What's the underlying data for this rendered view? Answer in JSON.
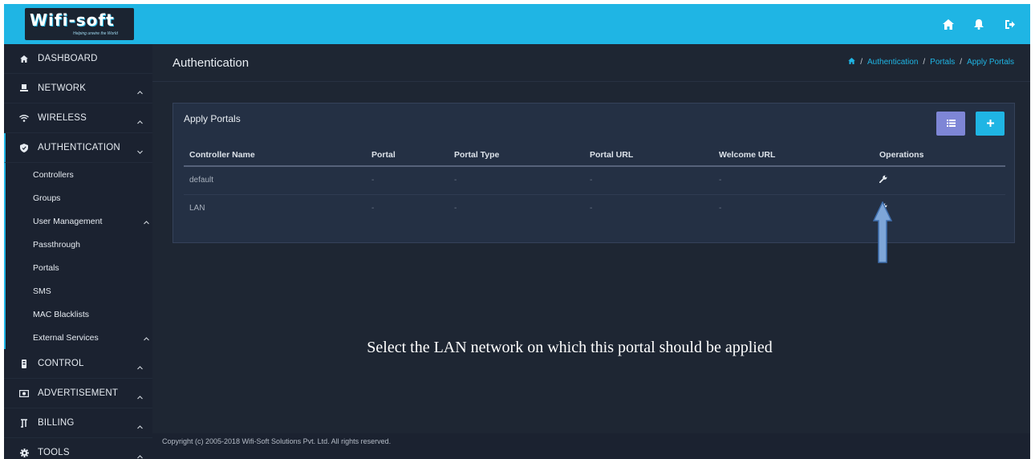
{
  "app": {
    "logo_text": "Wifi-soft",
    "logo_tagline": "Helping unwire the World"
  },
  "topbar": {
    "icons": [
      "home-icon",
      "bell-icon",
      "logout-icon"
    ]
  },
  "sidebar": {
    "items": [
      {
        "label": "DASHBOARD",
        "icon": "home-icon"
      },
      {
        "label": "NETWORK",
        "icon": "monitor-icon"
      },
      {
        "label": "WIRELESS",
        "icon": "wifi-icon"
      },
      {
        "label": "AUTHENTICATION",
        "icon": "shield-icon"
      },
      {
        "label": "CONTROL",
        "icon": "control-icon"
      },
      {
        "label": "ADVERTISEMENT",
        "icon": "ad-icon"
      },
      {
        "label": "BILLING",
        "icon": "billing-icon"
      },
      {
        "label": "TOOLS",
        "icon": "gear-icon"
      }
    ],
    "auth_submenu": [
      "Controllers",
      "Groups",
      "User Management",
      "Passthrough",
      "Portals",
      "SMS",
      "MAC Blacklists",
      "External Services"
    ]
  },
  "header": {
    "title": "Authentication",
    "breadcrumb": [
      "Authentication",
      "Portals",
      "Apply Portals"
    ]
  },
  "panel": {
    "title": "Apply Portals",
    "columns": [
      "Controller Name",
      "Portal",
      "Portal Type",
      "Portal URL",
      "Welcome URL",
      "Operations"
    ],
    "rows": [
      {
        "name": "default",
        "portal": "-",
        "portal_type": "-",
        "portal_url": "-",
        "welcome_url": "-"
      },
      {
        "name": "LAN",
        "portal": "-",
        "portal_type": "-",
        "portal_url": "-",
        "welcome_url": "-"
      }
    ]
  },
  "annotation": {
    "caption": "Select the LAN network on which this portal should be applied"
  },
  "footer": {
    "copyright": "Copyright (c) 2005-2018 Wifi-Soft Solutions Pvt. Ltd. All rights reserved."
  },
  "colors": {
    "accent": "#1fb5e4",
    "list_button": "#7e86d6",
    "background": "#1e2633",
    "sidebar": "#1b2230",
    "panel": "#243044",
    "arrow": "#7ea6d8"
  }
}
